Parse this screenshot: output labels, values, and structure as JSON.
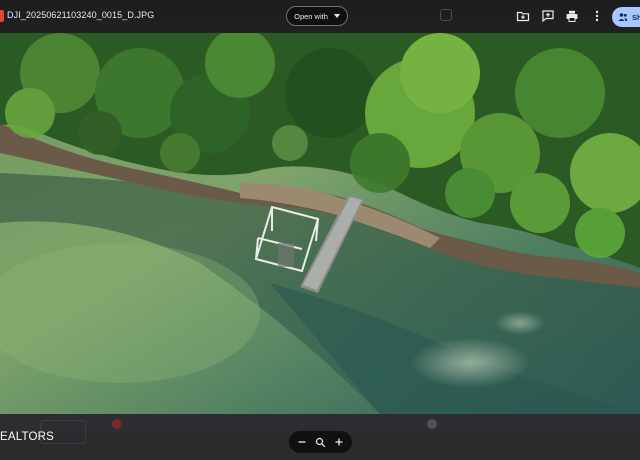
{
  "window": {
    "filename": "DJI_20250621103240_0015_D.JPG"
  },
  "toolbar": {
    "open_with_label": "Open with",
    "icons": [
      "add-to-drive-icon",
      "comment-icon",
      "print-icon",
      "more-vert-icon"
    ],
    "share_label": "Sh"
  },
  "photo": {
    "subject": "aerial-lake-dock"
  },
  "overlay": {
    "left_text": "EALTORS"
  },
  "zoom": {
    "icons": [
      "zoom-out-icon",
      "zoom-search-icon",
      "zoom-in-icon"
    ]
  },
  "colors": {
    "topbar": "#1f2021",
    "share_button": "#a8c7fa",
    "file_icon": "#ea4335"
  }
}
